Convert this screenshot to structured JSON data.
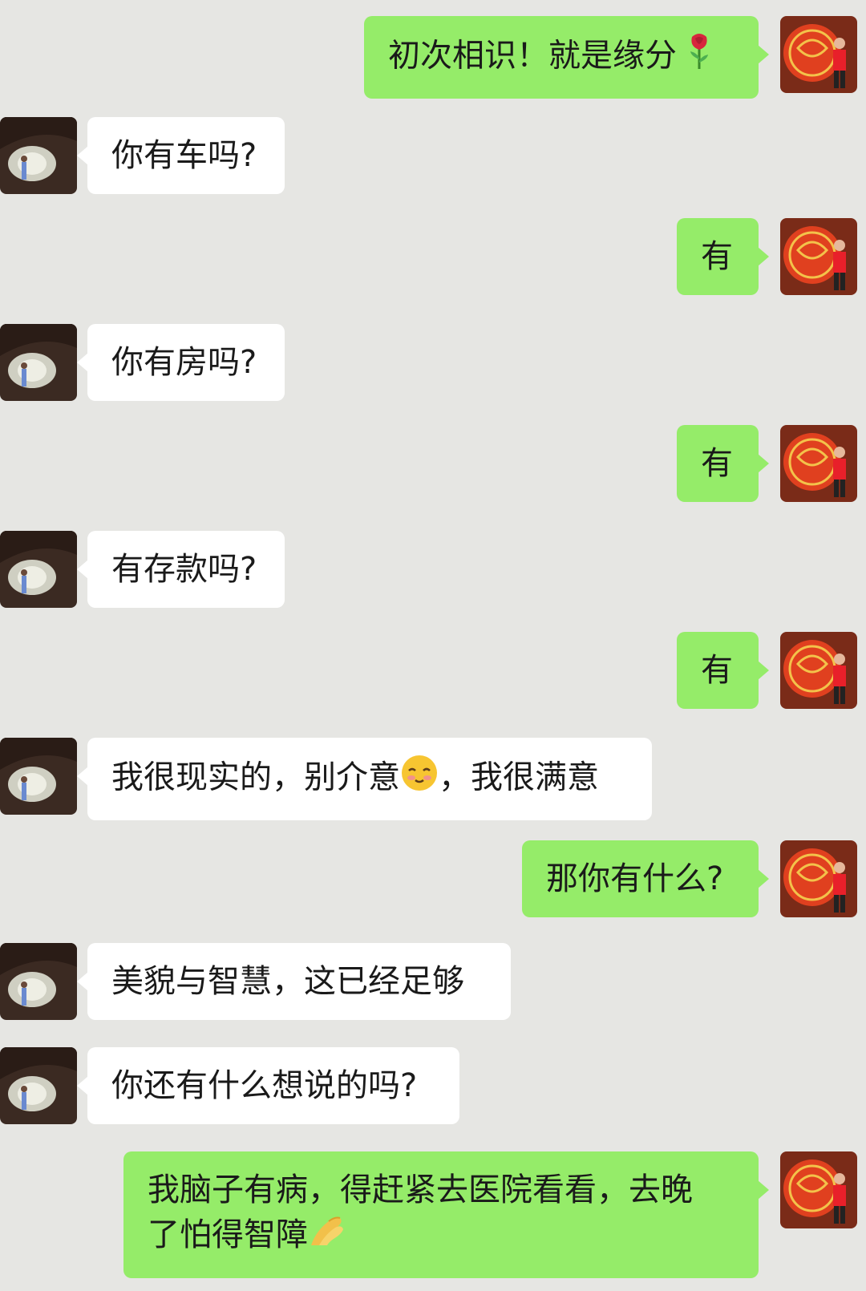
{
  "messages": [
    {
      "side": "out",
      "text": "初次相识！就是缘分",
      "emoji": "rose-icon"
    },
    {
      "side": "in",
      "text": "你有车吗?"
    },
    {
      "side": "out",
      "text": "有"
    },
    {
      "side": "in",
      "text": "你有房吗?"
    },
    {
      "side": "out",
      "text": "有"
    },
    {
      "side": "in",
      "text": "有存款吗?"
    },
    {
      "side": "out",
      "text": "有"
    },
    {
      "side": "in",
      "text_before": "我很现实的，别介意",
      "emoji": "blushing-face-icon",
      "text_after": "，我很满意"
    },
    {
      "side": "out",
      "text": "那你有什么?"
    },
    {
      "side": "in",
      "text": "美貌与智慧，这已经足够"
    },
    {
      "side": "in",
      "text": "你还有什么想说的吗?"
    },
    {
      "side": "out",
      "line1": "我脑子有病，得赶紧去医院看看，去晚",
      "line2": "了怕得智障",
      "emoji": "pinched-fingers-icon"
    }
  ],
  "colors": {
    "background": "#e6e6e3",
    "incoming_bubble": "#ffffff",
    "outgoing_bubble": "#95ec69",
    "text": "#1a1a1a"
  }
}
